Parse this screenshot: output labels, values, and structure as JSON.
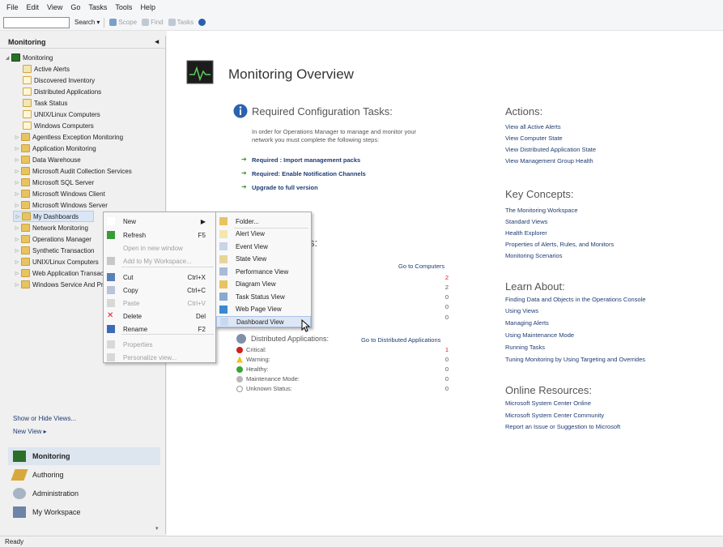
{
  "menubar": [
    "File",
    "Edit",
    "View",
    "Go",
    "Tasks",
    "Tools",
    "Help"
  ],
  "toolbar": {
    "search_label": "Search",
    "scope_label": "Scope",
    "find_label": "Find",
    "tasks_label": "Tasks"
  },
  "leftpane": {
    "title": "Monitoring",
    "tree_root": "Monitoring",
    "tree_items": [
      "Active Alerts",
      "Discovered Inventory",
      "Distributed Applications",
      "Task Status",
      "UNIX/Linux Computers",
      "Windows Computers",
      "Agentless Exception Monitoring",
      "Application Monitoring",
      "Data Warehouse",
      "Microsoft Audit Collection Services",
      "Microsoft SQL Server",
      "Microsoft Windows Client",
      "Microsoft Windows Server",
      "My Dashboards",
      "Network Monitoring",
      "Operations Manager",
      "Synthetic Transaction",
      "UNIX/Linux Computers",
      "Web Application Transaction Monitoring",
      "Windows Service And Process Monitoring"
    ],
    "links": [
      "Show or Hide Views...",
      "New View ▸"
    ],
    "wunderbar": [
      "Monitoring",
      "Authoring",
      "Administration",
      "My Workspace"
    ]
  },
  "status": "Ready",
  "main": {
    "title": "Monitoring Overview",
    "required_title": "Required Configuration Tasks:",
    "required_desc_1": "In order for Operations Manager to manage and monitor your",
    "required_desc_2": "network you must complete the following steps:",
    "tasks": [
      "Required : Import management packs",
      "Required: Enable Notification Channels",
      "Upgrade to full version"
    ],
    "computers_partial": "s:",
    "goto_computers": "Go to Computers",
    "computer_values": [
      "2",
      "2",
      "0",
      "0",
      "0"
    ],
    "distributed_title": "Distributed Applications:",
    "goto_distributed": "Go to Distributed Applications",
    "distributed_states": [
      {
        "label": "Critical:",
        "value": "1"
      },
      {
        "label": "Warning:",
        "value": "0"
      },
      {
        "label": "Healthy:",
        "value": "0"
      },
      {
        "label": "Maintenance Mode:",
        "value": "0"
      },
      {
        "label": "Unknown Status:",
        "value": "0"
      }
    ],
    "actions_title": "Actions:",
    "actions": [
      "View all Active Alerts",
      "View Computer State",
      "View Distributed Application State",
      "View Management Group Health"
    ],
    "key_title": "Key Concepts:",
    "key": [
      "The Monitoring Workspace",
      "Standard Views",
      "Health Explorer",
      "Properties of Alerts, Rules, and Monitors",
      "Monitoring Scenarios"
    ],
    "learn_title": "Learn About:",
    "learn": [
      "Finding Data and Objects in the Operations Console",
      "Using Views",
      "Managing Alerts",
      "Using Maintenance Mode",
      "Running Tasks",
      "Tuning Monitoring by Using Targeting and Overrides"
    ],
    "online_title": "Online Resources:",
    "online": [
      "Microsoft System Center Online",
      "Microsoft System Center Community",
      "Report an Issue or Suggestion to Microsoft"
    ]
  },
  "context_menu": {
    "items": [
      {
        "label": "New",
        "shortcut": "▶"
      },
      {
        "label": "Refresh",
        "shortcut": "F5"
      },
      {
        "label": "Open in new window",
        "shortcut": ""
      },
      {
        "label": "Add to My Workspace...",
        "shortcut": ""
      },
      {
        "label": "Cut",
        "shortcut": "Ctrl+X"
      },
      {
        "label": "Copy",
        "shortcut": "Ctrl+C"
      },
      {
        "label": "Paste",
        "shortcut": "Ctrl+V"
      },
      {
        "label": "Delete",
        "shortcut": "Del"
      },
      {
        "label": "Rename",
        "shortcut": "F2"
      },
      {
        "label": "Properties",
        "shortcut": ""
      },
      {
        "label": "Personalize view...",
        "shortcut": ""
      }
    ]
  },
  "submenu": {
    "items": [
      "Folder...",
      "Alert View",
      "Event View",
      "State View",
      "Performance View",
      "Diagram View",
      "Task Status View",
      "Web Page View",
      "Dashboard View"
    ]
  }
}
